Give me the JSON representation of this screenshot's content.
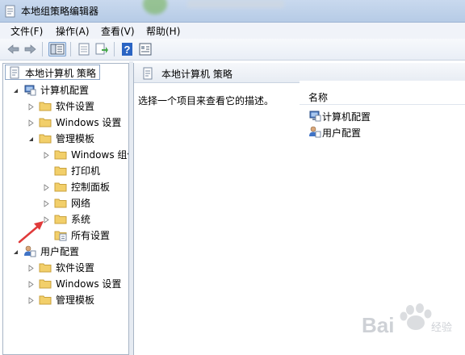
{
  "window": {
    "title": "本地组策略编辑器",
    "app_icon": "policy-editor-icon"
  },
  "menu": {
    "items": [
      "文件(F)",
      "操作(A)",
      "查看(V)",
      "帮助(H)"
    ]
  },
  "toolbar": {
    "buttons": [
      "back-arrow-icon",
      "forward-arrow-icon",
      "show-hide-tree-icon",
      "properties-icon",
      "export-list-icon",
      "help-icon",
      "view-icon"
    ]
  },
  "tree": {
    "root": "本地计算机 策略",
    "computer_config": "计算机配置",
    "software_settings": "软件设置",
    "windows_settings": "Windows 设置",
    "admin_templates": "管理模板",
    "windows_components": "Windows 组件",
    "printers": "打印机",
    "control_panel": "控制面板",
    "network": "网络",
    "system": "系统",
    "all_settings": "所有设置",
    "user_config": "用户配置",
    "user_software_settings": "软件设置",
    "user_windows_settings": "Windows 设置",
    "user_admin_templates": "管理模板"
  },
  "details": {
    "title": "本地计算机 策略",
    "description": "选择一个项目来查看它的描述。",
    "column_name": "名称",
    "items": [
      "计算机配置",
      "用户配置"
    ]
  },
  "watermark": {
    "text": "Bai",
    "sub": "经验"
  },
  "colors": {
    "folder": "#f2cf6a",
    "annotation_arrow": "#e03a3a",
    "selection_border": "#8ea6c6"
  }
}
